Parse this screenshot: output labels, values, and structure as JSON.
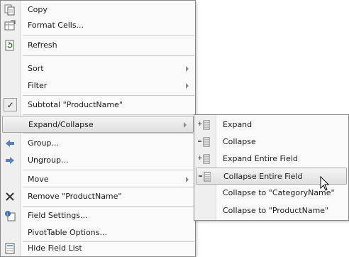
{
  "main_menu": {
    "items": [
      {
        "label": "Copy",
        "icon": "copy-icon"
      },
      {
        "label": "Format Cells...",
        "icon": "format-cells-icon"
      },
      {
        "label": "Refresh",
        "icon": "refresh-icon"
      },
      {
        "label": "Sort",
        "has_submenu": true
      },
      {
        "label": "Filter",
        "has_submenu": true
      },
      {
        "label": "Subtotal \"ProductName\"",
        "checked": true
      },
      {
        "label": "Expand/Collapse",
        "has_submenu": true,
        "highlighted": true
      },
      {
        "label": "Group...",
        "icon": "group-arrow-icon"
      },
      {
        "label": "Ungroup...",
        "icon": "ungroup-arrow-icon"
      },
      {
        "label": "Move",
        "has_submenu": true
      },
      {
        "label": "Remove \"ProductName\"",
        "icon": "remove-x-icon"
      },
      {
        "label": "Field Settings...",
        "icon": "field-settings-icon"
      },
      {
        "label": "PivotTable Options..."
      },
      {
        "label": "Hide Field List",
        "icon": "field-list-icon"
      }
    ]
  },
  "sub_menu": {
    "items": [
      {
        "label": "Expand",
        "icon": "expand-icon"
      },
      {
        "label": "Collapse",
        "icon": "collapse-icon"
      },
      {
        "label": "Expand Entire Field",
        "icon": "expand-field-icon"
      },
      {
        "label": "Collapse Entire Field",
        "icon": "collapse-field-icon",
        "highlighted": true
      },
      {
        "label": "Collapse to \"CategoryName\""
      },
      {
        "label": "Collapse to \"ProductName\""
      }
    ]
  },
  "colors": {
    "highlight": "#e2e2e2",
    "gutter": "#efefef",
    "border": "#8a8a8a"
  }
}
